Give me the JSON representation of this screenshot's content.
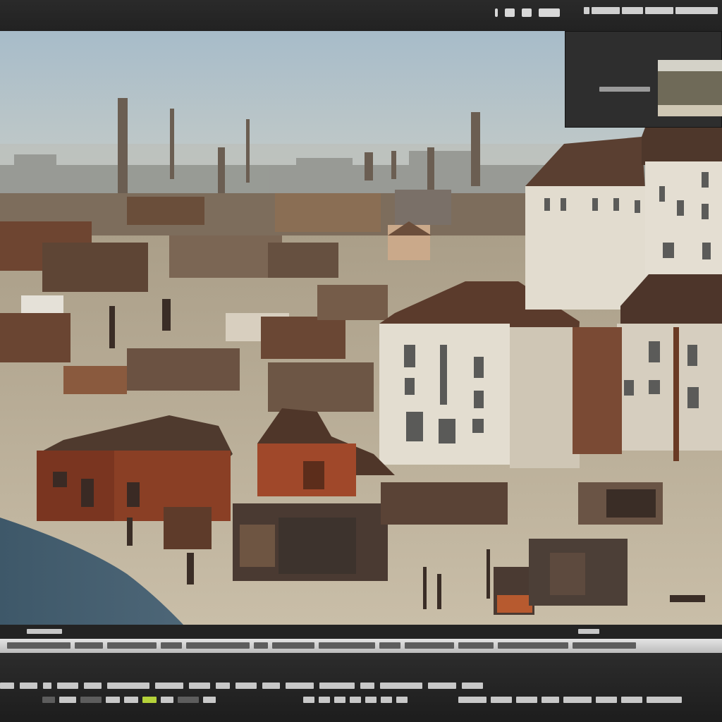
{
  "top_bar": {
    "icons": [
      "panel-icon",
      "grid-icon",
      "camera-icon",
      "menu-icon"
    ]
  },
  "navigator": {
    "icons": [
      "thumbnail-icon"
    ]
  },
  "timeline": {
    "icons": [
      "play-icon",
      "stop-icon",
      "keyframe-icon",
      "loop-icon"
    ]
  },
  "colors": {
    "chrome_dark": "#222222",
    "chrome_light": "#cfcfcf",
    "accent": "#b5d23a",
    "sky": "#a9bcc7",
    "ground": "#b9ad95",
    "wood": "#7a3b25",
    "plaster": "#e3ddd0",
    "water": "#3c5566"
  }
}
